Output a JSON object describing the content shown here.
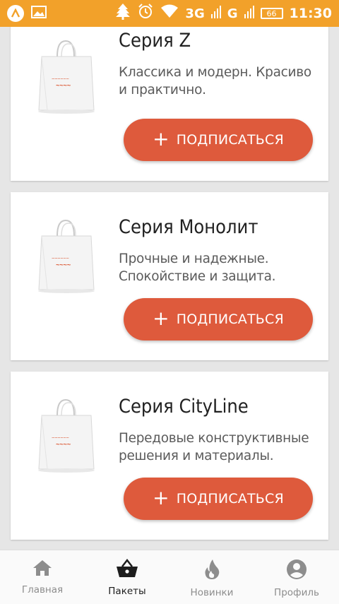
{
  "status_bar": {
    "network": "3G",
    "network2": "G",
    "battery": "66",
    "time": "11:30"
  },
  "cards": [
    {
      "title": "Серия Z",
      "description": "Классика и модерн. Красиво и практично.",
      "button_label": "ПОДПИСАТЬСЯ",
      "button_icon": "+"
    },
    {
      "title": "Серия Монолит",
      "description": "Прочные и надежные. Спокойствие и защита.",
      "button_label": "ПОДПИСАТЬСЯ",
      "button_icon": "+"
    },
    {
      "title": "Серия CityLine",
      "description": "Передовые конструктивные решения и материалы.",
      "button_label": "ПОДПИСАТЬСЯ",
      "button_icon": "+"
    }
  ],
  "bottom_nav": {
    "items": [
      {
        "label": "Главная",
        "icon": "home-icon",
        "active": false
      },
      {
        "label": "Пакеты",
        "icon": "basket-icon",
        "active": true
      },
      {
        "label": "Новинки",
        "icon": "flame-icon",
        "active": false
      },
      {
        "label": "Профиль",
        "icon": "account-icon",
        "active": false
      }
    ]
  },
  "colors": {
    "status_bar": "#f2a12a",
    "button": "#de5a3c",
    "nav_active": "#1d1d1d",
    "nav_inactive": "#8d8d8d"
  }
}
